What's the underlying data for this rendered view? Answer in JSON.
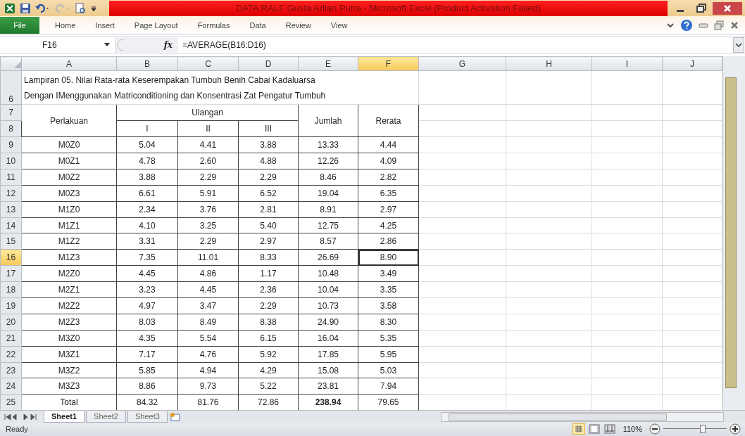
{
  "window": {
    "title": "DATA RALF Gusfa Arlian Putra  -  Microsoft Excel (Product Activation Failed)"
  },
  "ribbon_tabs": [
    {
      "label": "File",
      "kind": "file"
    },
    {
      "label": "Home",
      "kind": "tab"
    },
    {
      "label": "Insert",
      "kind": "tab"
    },
    {
      "label": "Page Layout",
      "kind": "tab"
    },
    {
      "label": "Formulas",
      "kind": "tab"
    },
    {
      "label": "Data",
      "kind": "tab"
    },
    {
      "label": "Review",
      "kind": "tab"
    },
    {
      "label": "View",
      "kind": "tab"
    }
  ],
  "formula_bar": {
    "name_box": "F16",
    "fx_label": "fx",
    "formula": "=AVERAGE(B16:D16)"
  },
  "columns": [
    {
      "label": "A",
      "selected": false
    },
    {
      "label": "B",
      "selected": false
    },
    {
      "label": "C",
      "selected": false
    },
    {
      "label": "D",
      "selected": false
    },
    {
      "label": "E",
      "selected": false
    },
    {
      "label": "F",
      "selected": true
    },
    {
      "label": "G",
      "selected": false
    },
    {
      "label": "H",
      "selected": false
    },
    {
      "label": "I",
      "selected": false
    },
    {
      "label": "J",
      "selected": false
    }
  ],
  "sheet": {
    "title_row": "6",
    "title_lines": [
      "Lampiran 05. Nilai Rata-rata Keserempakan Tumbuh Benih Cabai Kadaluarsa",
      "Dengan IMenggunakan Matriconditioning dan Konsentrasi Zat Pengatur Tumbuh"
    ],
    "header_rows": [
      "7",
      "8"
    ],
    "header": {
      "treatment": "Perlakuan",
      "replicate": "Ulangan",
      "replicates": [
        "I",
        "II",
        "III"
      ],
      "sum": "Jumlah",
      "mean": "Rerata"
    },
    "rows": [
      {
        "row": "9",
        "selected": false,
        "cells": [
          "M0Z0",
          "5.04",
          "4.41",
          "3.88",
          "13.33",
          "4.44"
        ]
      },
      {
        "row": "10",
        "selected": false,
        "cells": [
          "M0Z1",
          "4.78",
          "2.60",
          "4.88",
          "12.26",
          "4.09"
        ]
      },
      {
        "row": "11",
        "selected": false,
        "cells": [
          "M0Z2",
          "3.88",
          "2.29",
          "2.29",
          "8.46",
          "2.82"
        ]
      },
      {
        "row": "12",
        "selected": false,
        "cells": [
          "M0Z3",
          "6.61",
          "5.91",
          "6.52",
          "19.04",
          "6.35"
        ]
      },
      {
        "row": "13",
        "selected": false,
        "cells": [
          "M1Z0",
          "2.34",
          "3.76",
          "2.81",
          "8.91",
          "2.97"
        ]
      },
      {
        "row": "14",
        "selected": false,
        "cells": [
          "M1Z1",
          "4.10",
          "3.25",
          "5.40",
          "12.75",
          "4.25"
        ]
      },
      {
        "row": "15",
        "selected": false,
        "cells": [
          "M1Z2",
          "3.31",
          "2.29",
          "2.97",
          "8.57",
          "2.86"
        ]
      },
      {
        "row": "16",
        "selected": true,
        "cells": [
          "M1Z3",
          "7.35",
          "11.01",
          "8.33",
          "26.69",
          "8.90"
        ]
      },
      {
        "row": "17",
        "selected": false,
        "cells": [
          "M2Z0",
          "4.45",
          "4.86",
          "1.17",
          "10.48",
          "3.49"
        ]
      },
      {
        "row": "18",
        "selected": false,
        "cells": [
          "M2Z1",
          "3.23",
          "4.45",
          "2.36",
          "10.04",
          "3.35"
        ]
      },
      {
        "row": "19",
        "selected": false,
        "cells": [
          "M2Z2",
          "4.97",
          "3.47",
          "2.29",
          "10.73",
          "3.58"
        ]
      },
      {
        "row": "20",
        "selected": false,
        "cells": [
          "M2Z3",
          "8.03",
          "8.49",
          "8.38",
          "24.90",
          "8.30"
        ]
      },
      {
        "row": "21",
        "selected": false,
        "cells": [
          "M3Z0",
          "4.35",
          "5.54",
          "6.15",
          "16.04",
          "5.35"
        ]
      },
      {
        "row": "22",
        "selected": false,
        "cells": [
          "M3Z1",
          "7.17",
          "4.76",
          "5.92",
          "17.85",
          "5.95"
        ]
      },
      {
        "row": "23",
        "selected": false,
        "cells": [
          "M3Z2",
          "5.85",
          "4.94",
          "4.29",
          "15.08",
          "5.03"
        ]
      },
      {
        "row": "24",
        "selected": false,
        "cells": [
          "M3Z3",
          "8.86",
          "9.73",
          "5.22",
          "23.81",
          "7.94"
        ]
      }
    ],
    "total": {
      "row": "25",
      "selected": false,
      "cells": [
        {
          "text": "Total",
          "bold": false
        },
        {
          "text": "84.32",
          "bold": false
        },
        {
          "text": "81.76",
          "bold": false
        },
        {
          "text": "72.86",
          "bold": false
        },
        {
          "text": "238.94",
          "bold": true
        },
        {
          "text": "79.65",
          "bold": false
        }
      ]
    }
  },
  "sheet_tabs": [
    {
      "label": "Sheet1",
      "selected": true
    },
    {
      "label": "Sheet2",
      "selected": false
    },
    {
      "label": "Sheet3",
      "selected": false
    }
  ],
  "status_bar": {
    "text": "Ready",
    "zoom": "110%",
    "level": 0.62
  }
}
